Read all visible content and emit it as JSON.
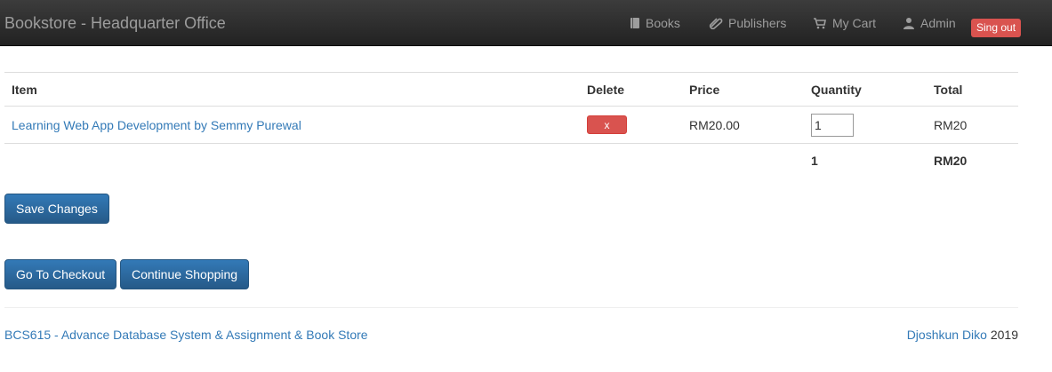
{
  "navbar": {
    "brand": "Bookstore - Headquarter Office",
    "items": [
      {
        "label": "Books",
        "icon": "book-icon"
      },
      {
        "label": "Publishers",
        "icon": "paperclip-icon"
      },
      {
        "label": "My Cart",
        "icon": "shopping-cart-icon"
      },
      {
        "label": "Admin",
        "icon": "user-icon"
      }
    ],
    "signout_label": "Sing out"
  },
  "cart": {
    "headers": {
      "item": "Item",
      "delete": "Delete",
      "price": "Price",
      "quantity": "Quantity",
      "total": "Total"
    },
    "rows": [
      {
        "item": "Learning Web App Development by Semmy Purewal",
        "delete_label": "x",
        "price": "RM20.00",
        "quantity": "1",
        "total": "RM20"
      }
    ],
    "summary": {
      "quantity": "1",
      "total": "RM20"
    }
  },
  "actions": {
    "save_label": "Save Changes",
    "checkout_label": "Go To Checkout",
    "continue_label": "Continue Shopping"
  },
  "footer": {
    "left": "BCS615 - Advance Database System & Assignment & Book Store",
    "author": "Djoshkun Diko",
    "year": "2019"
  },
  "colors": {
    "navbar_bg": "#222222",
    "link": "#337ab7",
    "danger": "#d9534f",
    "primary": "#286090"
  }
}
